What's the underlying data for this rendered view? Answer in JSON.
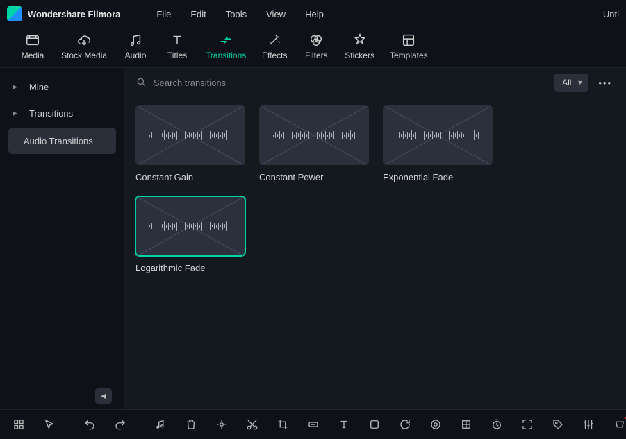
{
  "app": {
    "title": "Wondershare Filmora",
    "right_text": "Unti"
  },
  "menu": {
    "items": [
      "File",
      "Edit",
      "Tools",
      "View",
      "Help"
    ]
  },
  "tabs": [
    {
      "id": "media",
      "label": "Media"
    },
    {
      "id": "stock-media",
      "label": "Stock Media"
    },
    {
      "id": "audio",
      "label": "Audio"
    },
    {
      "id": "titles",
      "label": "Titles"
    },
    {
      "id": "transitions",
      "label": "Transitions",
      "active": true
    },
    {
      "id": "effects",
      "label": "Effects"
    },
    {
      "id": "filters",
      "label": "Filters"
    },
    {
      "id": "stickers",
      "label": "Stickers"
    },
    {
      "id": "templates",
      "label": "Templates"
    }
  ],
  "sidebar": {
    "items": [
      {
        "label": "Mine",
        "expandable": true
      },
      {
        "label": "Transitions",
        "expandable": true
      },
      {
        "label": "Audio Transitions",
        "selected": true
      }
    ]
  },
  "search": {
    "placeholder": "Search transitions"
  },
  "filter": {
    "label": "All"
  },
  "cards": [
    {
      "id": "constant-gain",
      "label": "Constant Gain"
    },
    {
      "id": "constant-power",
      "label": "Constant Power"
    },
    {
      "id": "exponential-fade",
      "label": "Exponential Fade"
    },
    {
      "id": "logarithmic-fade",
      "label": "Logarithmic Fade",
      "selected": true
    }
  ],
  "icons": {
    "search": "search-icon",
    "more": "more-icon",
    "chevron_down": "chevron-down-icon",
    "chevron_left": "chevron-left-icon"
  }
}
